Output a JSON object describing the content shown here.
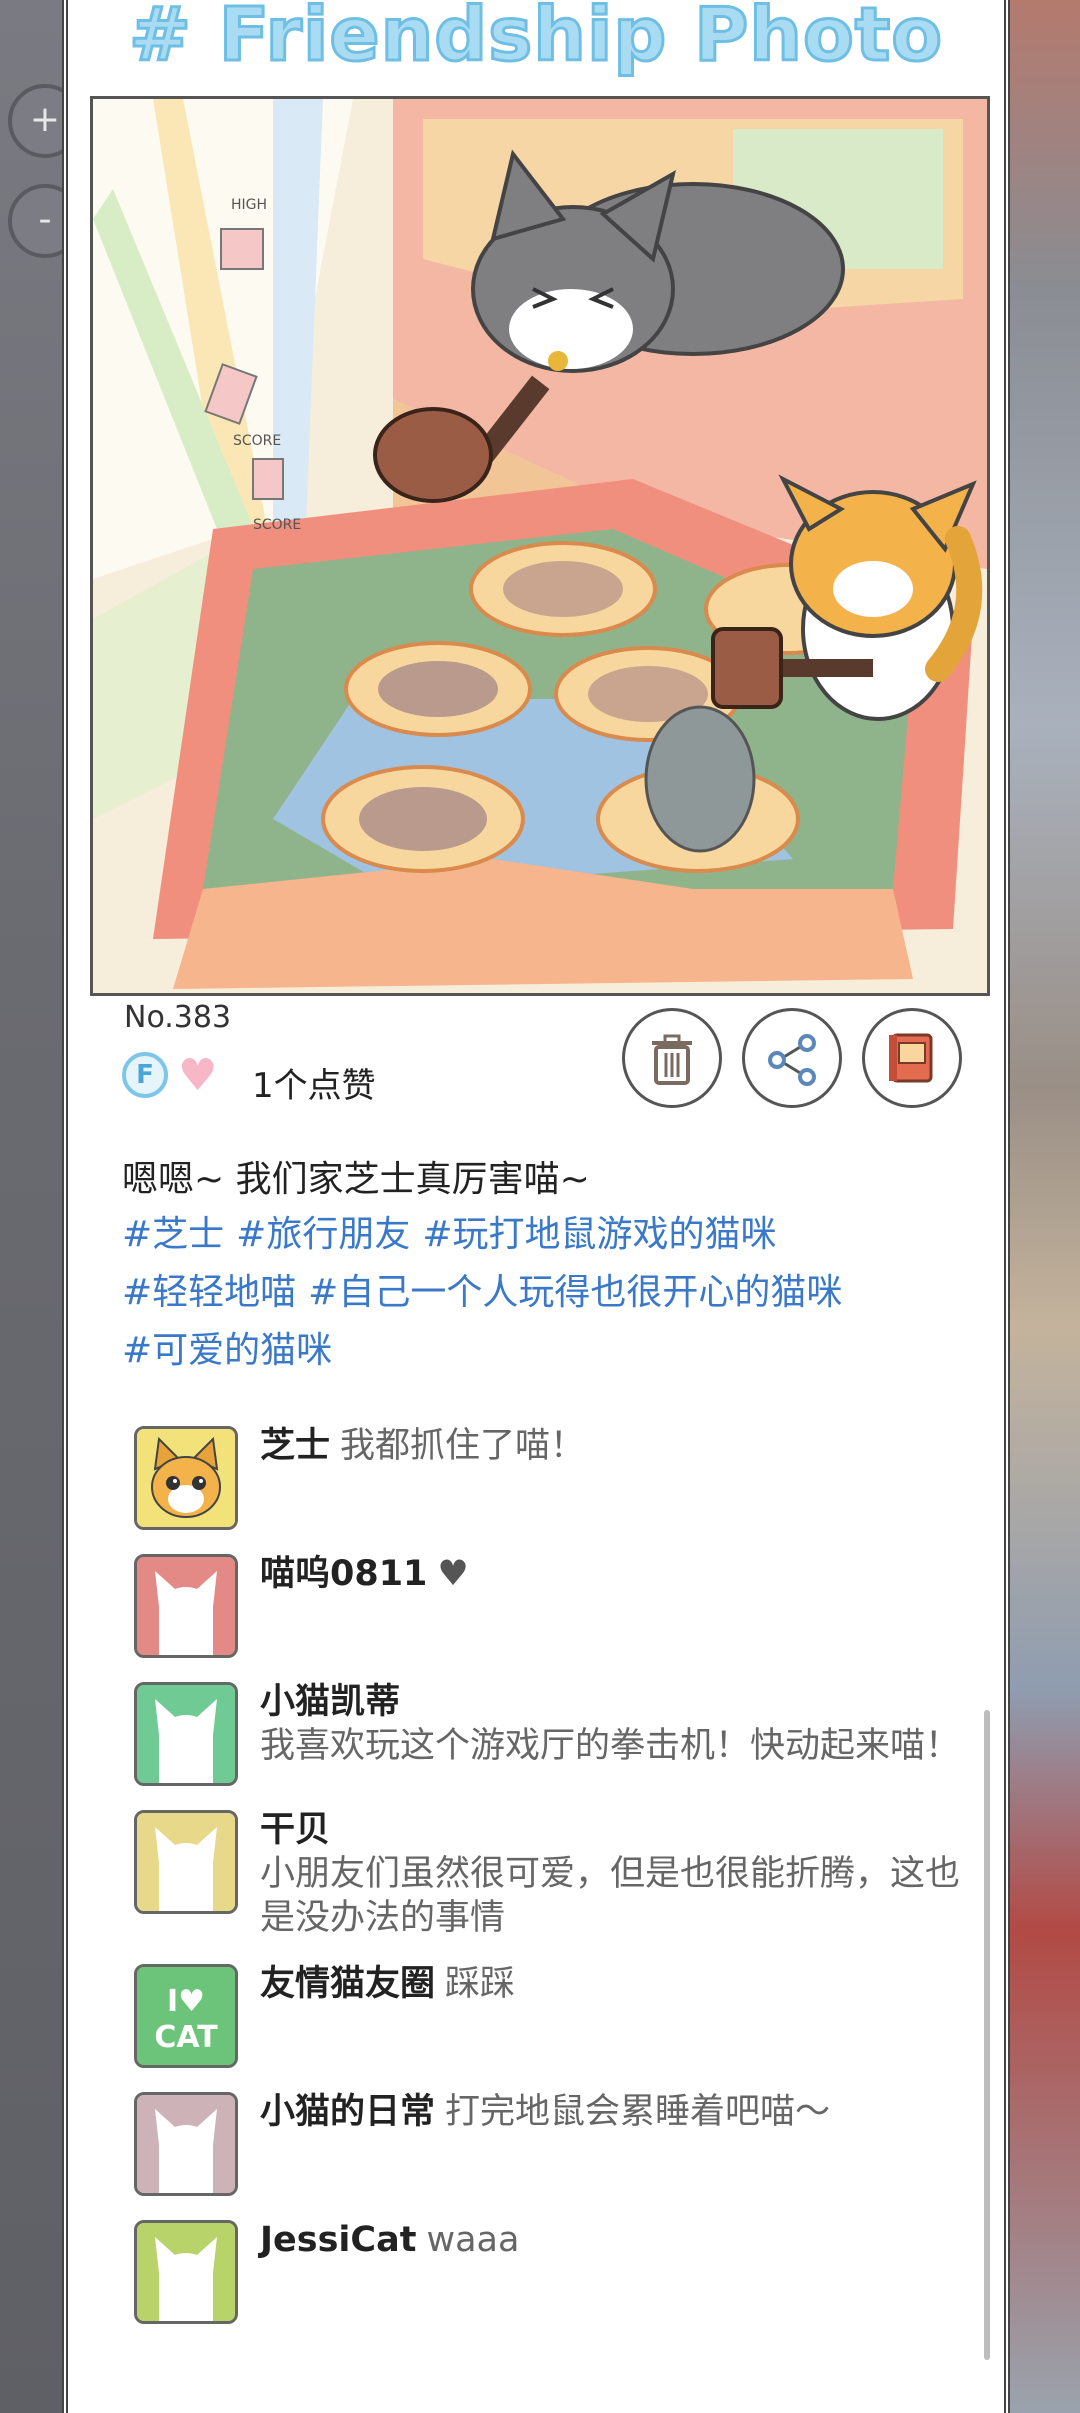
{
  "title": "# Friendship Photo",
  "zoom": {
    "in_label": "+",
    "out_label": "-"
  },
  "photo": {
    "number": "No.383",
    "badge_letter": "F",
    "likes_text": "1个点赞",
    "caption": "嗯嗯~ 我们家芝士真厉害喵~",
    "tags": [
      "#芝士",
      "#旅行朋友",
      "#玩打地鼠游戏的猫咪",
      "#轻轻地喵",
      "#自己一个人玩得也很开心的猫咪",
      "#可爱的猫咪"
    ],
    "sign_texts": [
      "HIGH",
      "SCORE",
      "SCORE"
    ]
  },
  "actions": [
    "delete",
    "share",
    "album"
  ],
  "comments": [
    {
      "name": "芝士",
      "text": "我都抓住了喵！",
      "avatar_color": "#f3e27a",
      "avatar": "cheese-cat"
    },
    {
      "name": "喵呜0811",
      "text": "♥",
      "avatar_color": "#e48a86",
      "avatar": "silhouette"
    },
    {
      "name": "小猫凯蒂",
      "text": "我喜欢玩这个游戏厅的拳击机！快动起来喵！",
      "avatar_color": "#6fcb93",
      "avatar": "silhouette"
    },
    {
      "name": "干贝",
      "text": "小朋友们虽然很可爱，但是也很能折腾，这也是没办法的事情",
      "avatar_color": "#e8d88a",
      "avatar": "silhouette"
    },
    {
      "name": "友情猫友圈",
      "text": "踩踩",
      "avatar_color": "#6cc47a",
      "avatar": "i-love-cat",
      "avatar_text": "I♥ CAT"
    },
    {
      "name": "小猫的日常",
      "text": "打完地鼠会累睡着吧喵～",
      "avatar_color": "#cdb3b8",
      "avatar": "silhouette"
    },
    {
      "name": "JessiCat",
      "text": "waaa",
      "avatar_color": "#b7d36a",
      "avatar": "silhouette"
    }
  ]
}
